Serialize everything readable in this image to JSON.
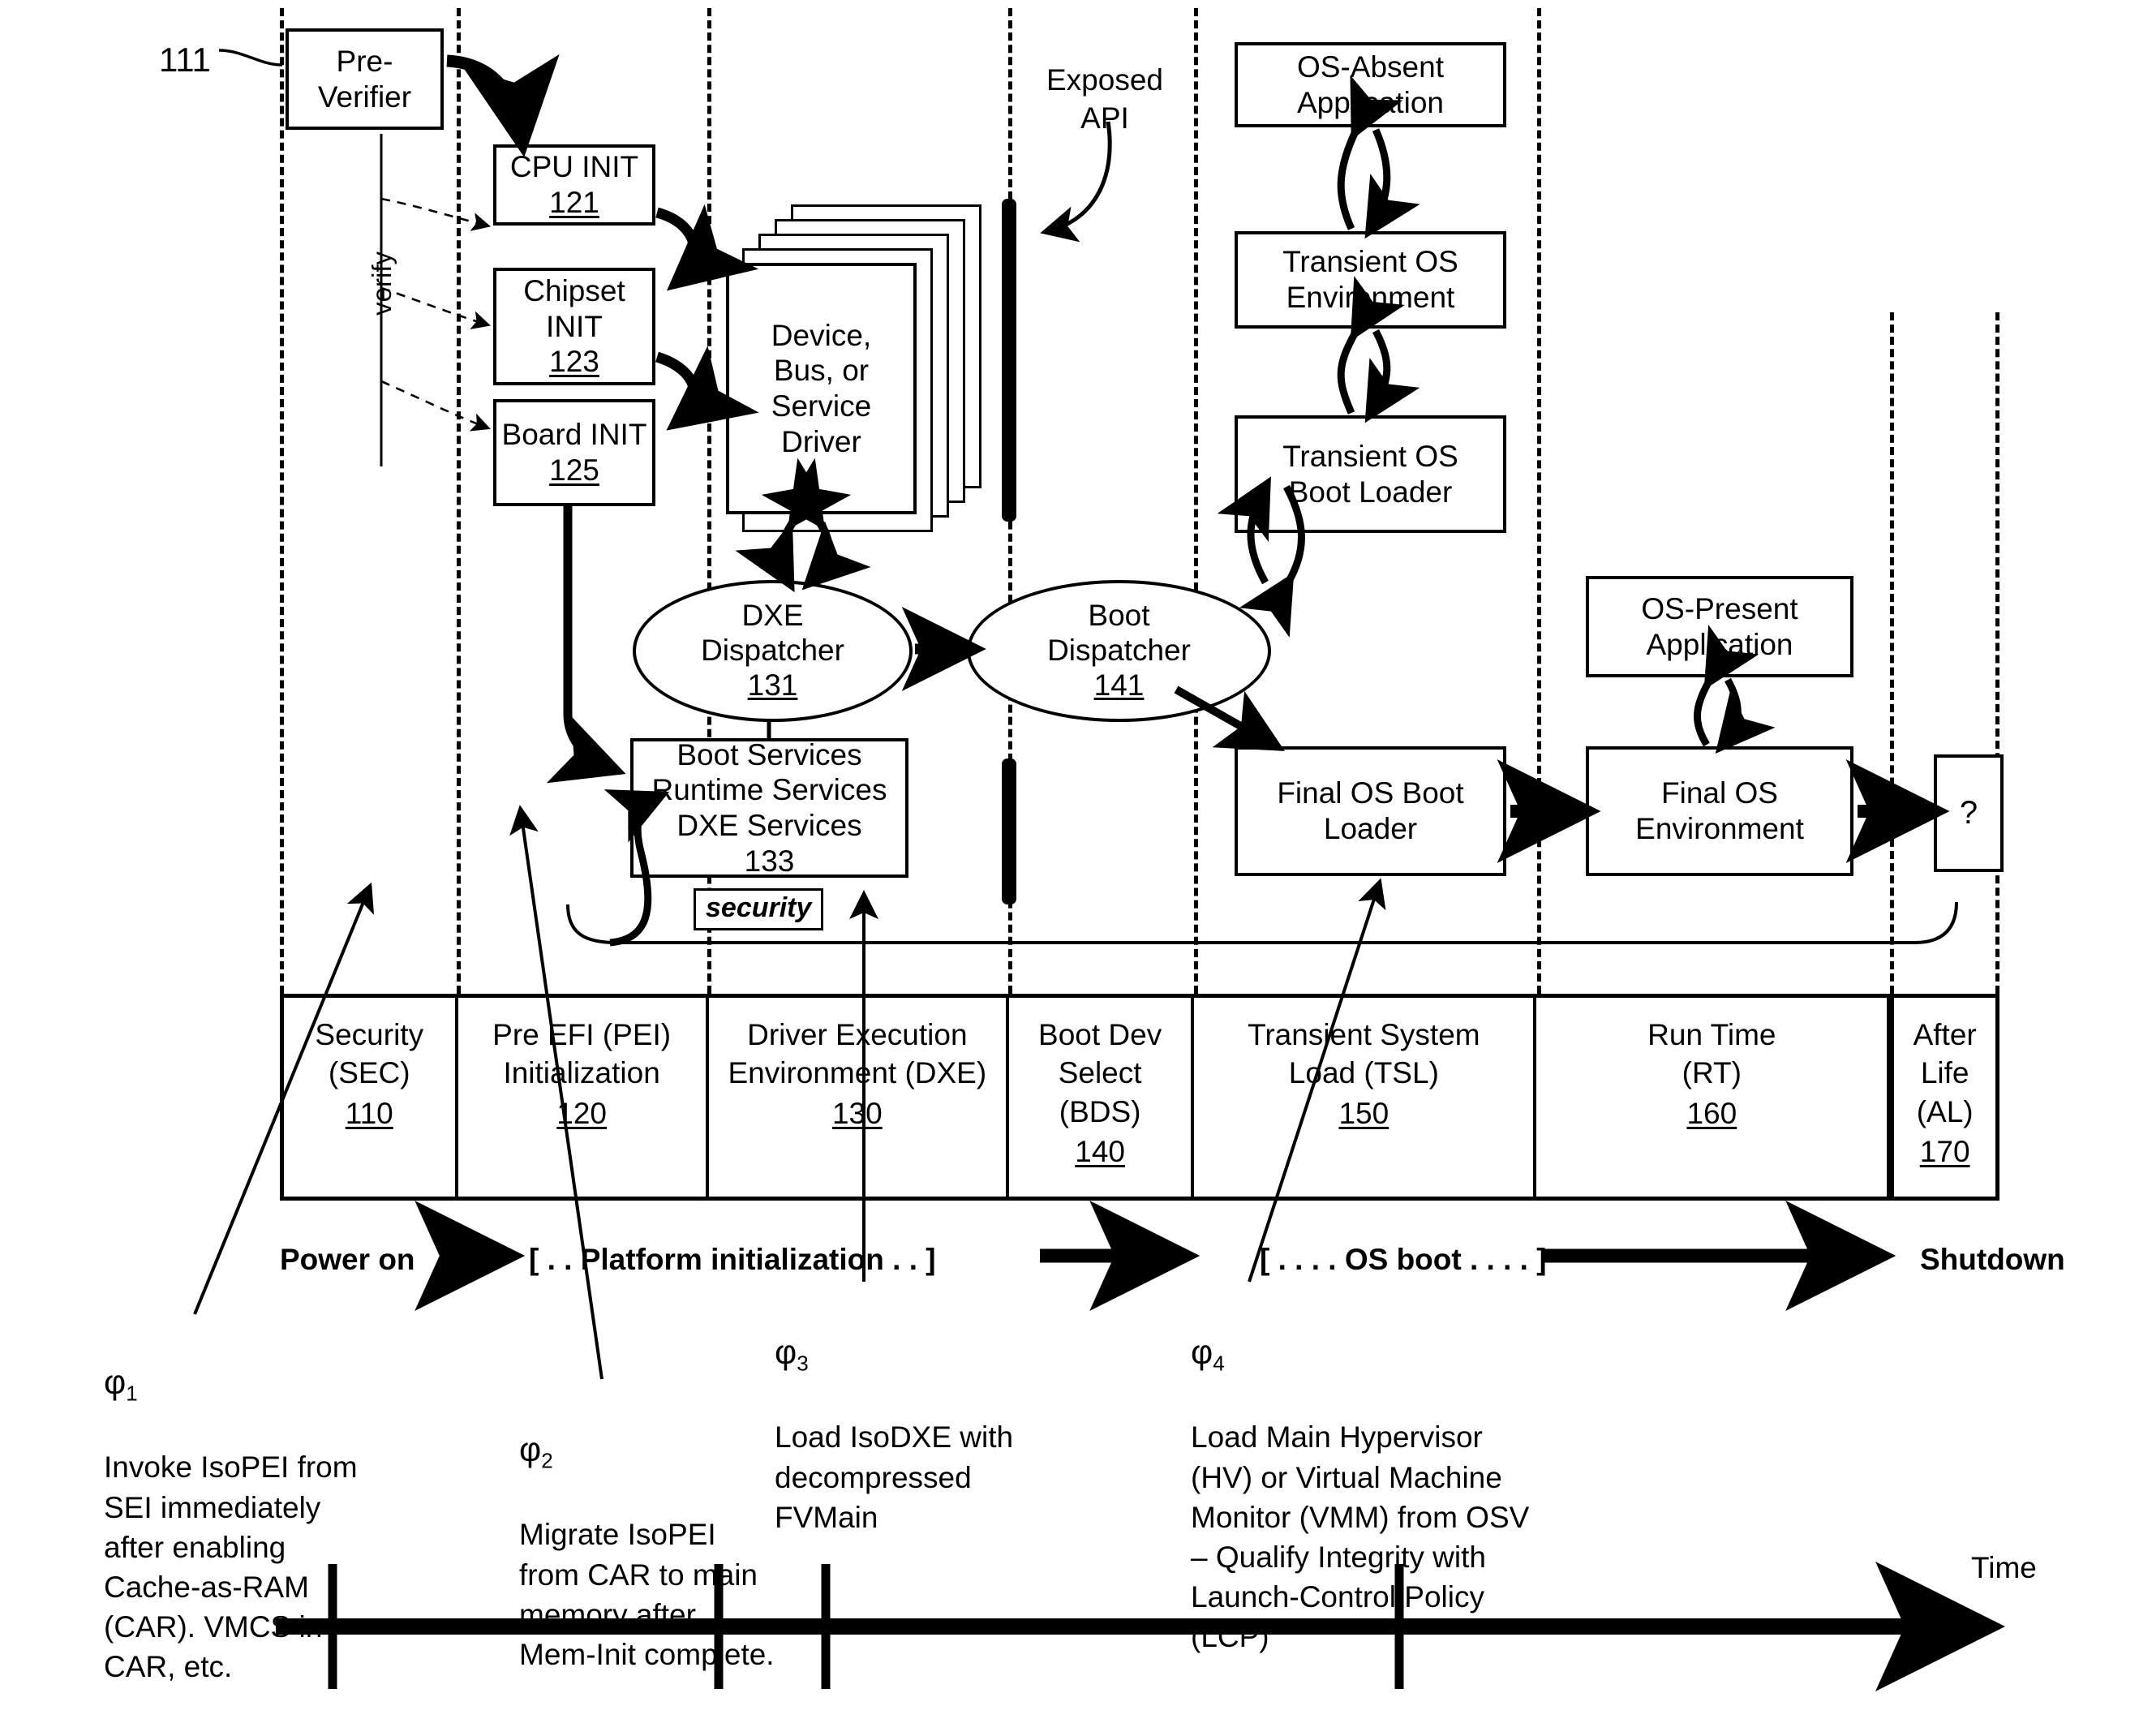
{
  "figure": {
    "ref_111": "111",
    "verify_label": "verify",
    "exposed_api_label": "Exposed\nAPI",
    "security_tag": "security",
    "time_label": "Time"
  },
  "boxes": {
    "pre_verifier": "Pre-\nVerifier",
    "cpu_init": {
      "title": "CPU INIT",
      "num": "121"
    },
    "chipset_init": {
      "title": "Chipset\nINIT",
      "num": "123"
    },
    "board_init": {
      "title": "Board INIT",
      "num": "125"
    },
    "driver_stack": "Device,\nBus, or\nService\nDriver",
    "dxe_dispatcher": {
      "title": "DXE\nDispatcher",
      "num": "131"
    },
    "boot_dispatcher": {
      "title": "Boot\nDispatcher",
      "num": "141"
    },
    "services": {
      "line1": "Boot Services",
      "line2": "Runtime Services",
      "line3": "DXE Services",
      "num": "133"
    },
    "os_absent_app": "OS-Absent\nApplication",
    "transient_os_env": "Transient OS\nEnvironment",
    "transient_os_boot_loader": "Transient OS\nBoot Loader",
    "final_os_boot_loader": "Final OS Boot\nLoader",
    "os_present_app": "OS-Present\nApplication",
    "final_os_env": "Final OS\nEnvironment",
    "afterlife": "?"
  },
  "phases": [
    {
      "name": "Security\n(SEC)",
      "num": "110"
    },
    {
      "name": "Pre EFI (PEI)\nInitialization",
      "num": "120"
    },
    {
      "name": "Driver Execution\nEnvironment (DXE)",
      "num": "130"
    },
    {
      "name": "Boot Dev\nSelect\n(BDS)",
      "num": "140"
    },
    {
      "name": "Transient System\nLoad (TSL)",
      "num": "150"
    },
    {
      "name": "Run Time\n(RT)",
      "num": "160"
    },
    {
      "name": "After\nLife\n(AL)",
      "num": "170"
    }
  ],
  "timeline": {
    "power_on": "Power on",
    "platform_init": "[ . . Platform initialization . . ]",
    "os_boot": "[ . . . . OS boot . . . . ]",
    "shutdown": "Shutdown"
  },
  "annotations": [
    {
      "symbol": "φ",
      "subscript": "1",
      "text": "Invoke IsoPEI from\nSEI immediately\nafter enabling\nCache-as-RAM\n(CAR).  VMCS in\nCAR, etc."
    },
    {
      "symbol": "φ",
      "subscript": "2",
      "text": "Migrate IsoPEI\nfrom CAR to main\nmemory after\nMem-Init complete."
    },
    {
      "symbol": "φ",
      "subscript": "3",
      "text": "Load IsoDXE with\ndecompressed\nFVMain"
    },
    {
      "symbol": "φ",
      "subscript": "4",
      "text": "Load Main Hypervisor\n(HV) or Virtual Machine\nMonitor (VMM) from OSV\n– Qualify Integrity with\nLaunch-Control Policy\n(LCP)"
    }
  ],
  "colors": {
    "ink": "#000000",
    "paper": "#ffffff"
  }
}
